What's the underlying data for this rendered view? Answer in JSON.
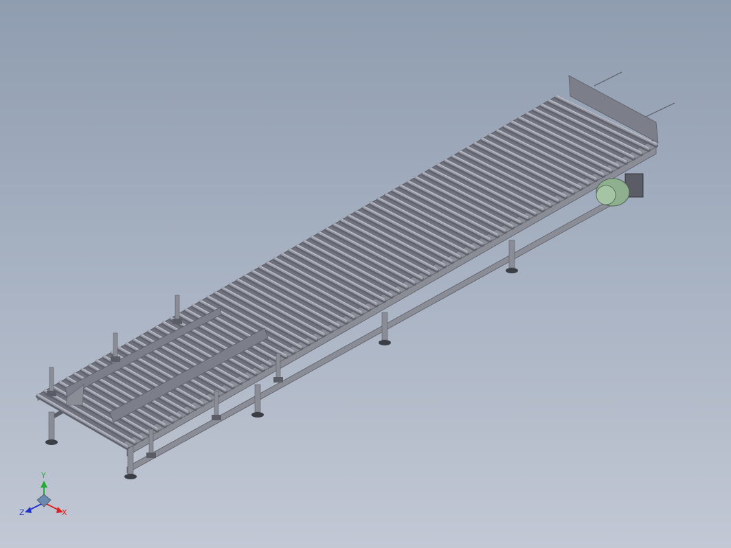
{
  "triad": {
    "y_label": "Y",
    "z_label": "Z",
    "x_label": "X",
    "colors": {
      "y": "#22aa33",
      "z": "#2233cc",
      "x": "#dd2222"
    }
  },
  "model": {
    "colors": {
      "frame": "#8a8c96",
      "frame_dark": "#5a5c66",
      "roller": "#9a9ca8",
      "roller_dark": "#60626e",
      "roller_light": "#c4c6d0",
      "guide": "#7c7e8a",
      "motor": "#8fb08f",
      "motor_dark": "#4d5e4d",
      "foot": "#3c3e46"
    }
  }
}
